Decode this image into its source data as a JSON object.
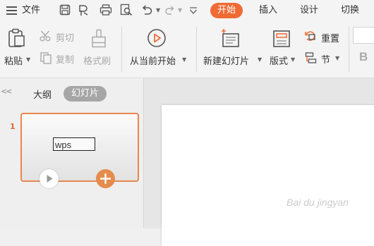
{
  "menu": {
    "file_label": "文件",
    "tabs": [
      {
        "label": "开始",
        "active": true
      },
      {
        "label": "插入",
        "active": false
      },
      {
        "label": "设计",
        "active": false
      },
      {
        "label": "切换",
        "active": false
      }
    ]
  },
  "ribbon": {
    "paste": "粘贴",
    "cut": "剪切",
    "copy": "复制",
    "format_painter": "格式刷",
    "from_current": "从当前开始",
    "new_slide": "新建幻灯片",
    "layout": "版式",
    "reset": "重置",
    "section": "节",
    "bold": "B"
  },
  "panel": {
    "tab_outline": "大纲",
    "tab_slides": "幻灯片",
    "collapse_glyph": "<<"
  },
  "thumbnail": {
    "number": "1",
    "text": "wps"
  },
  "watermark": "Bai du jingyan",
  "colors": {
    "accent": "#f06a35",
    "thumb_border": "#e7874e"
  }
}
